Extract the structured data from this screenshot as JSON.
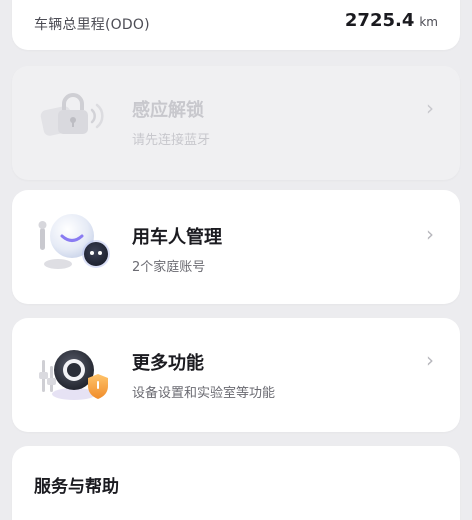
{
  "odometer": {
    "label": "车辆总里程(ODO)",
    "value": "2725.4",
    "unit": "km"
  },
  "sensor_unlock": {
    "title": "感应解锁",
    "subtitle": "请先连接蓝牙",
    "icon": "lock-bluetooth-icon",
    "enabled": false
  },
  "vehicle_users": {
    "title": "用车人管理",
    "subtitle": "2个家庭账号",
    "icon": "users-robot-icon"
  },
  "more_features": {
    "title": "更多功能",
    "subtitle": "设备设置和实验室等功能",
    "icon": "settings-knob-icon"
  },
  "service_help": {
    "title": "服务与帮助"
  },
  "colors": {
    "background": "#ececef",
    "card": "#ffffff",
    "disabled_card": "#f0f0f2",
    "accent_purple": "#8a7cf2",
    "accent_orange": "#f5a43a"
  }
}
